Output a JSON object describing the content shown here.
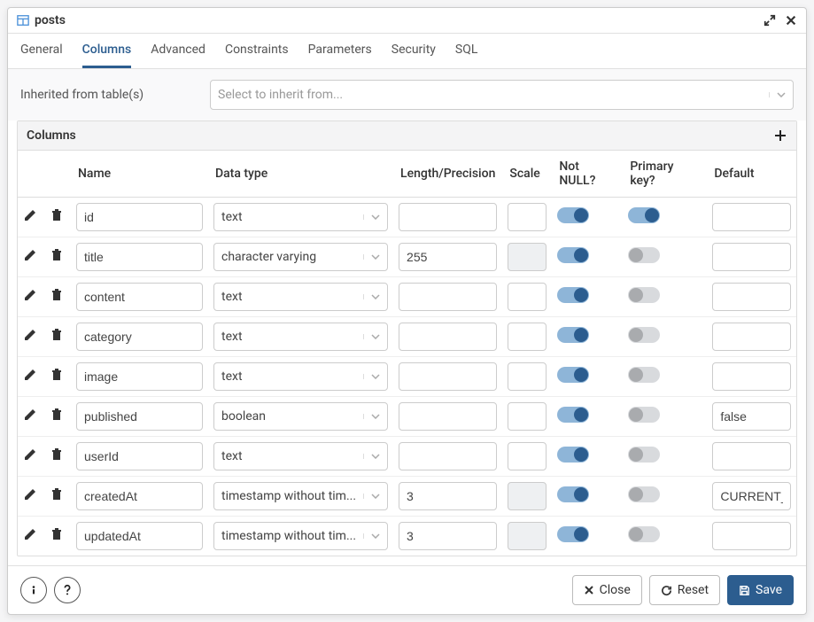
{
  "title": "posts",
  "tabs": [
    "General",
    "Columns",
    "Advanced",
    "Constraints",
    "Parameters",
    "Security",
    "SQL"
  ],
  "active_tab_index": 1,
  "inherit": {
    "label": "Inherited from table(s)",
    "placeholder": "Select to inherit from..."
  },
  "columns_section": {
    "title": "Columns",
    "headers": {
      "name": "Name",
      "datatype": "Data type",
      "length": "Length/Precision",
      "scale": "Scale",
      "notnull": "Not NULL?",
      "pk": "Primary key?",
      "default": "Default"
    },
    "rows": [
      {
        "name": "id",
        "datatype": "text",
        "length": "",
        "scale": "",
        "scale_disabled": false,
        "notnull": true,
        "pk": true,
        "default": ""
      },
      {
        "name": "title",
        "datatype": "character varying",
        "length": "255",
        "scale": "",
        "scale_disabled": true,
        "notnull": true,
        "pk": false,
        "default": ""
      },
      {
        "name": "content",
        "datatype": "text",
        "length": "",
        "scale": "",
        "scale_disabled": false,
        "notnull": true,
        "pk": false,
        "default": ""
      },
      {
        "name": "category",
        "datatype": "text",
        "length": "",
        "scale": "",
        "scale_disabled": false,
        "notnull": true,
        "pk": false,
        "default": ""
      },
      {
        "name": "image",
        "datatype": "text",
        "length": "",
        "scale": "",
        "scale_disabled": false,
        "notnull": true,
        "pk": false,
        "default": ""
      },
      {
        "name": "published",
        "datatype": "boolean",
        "length": "",
        "scale": "",
        "scale_disabled": false,
        "notnull": true,
        "pk": false,
        "default": "false"
      },
      {
        "name": "userId",
        "datatype": "text",
        "length": "",
        "scale": "",
        "scale_disabled": false,
        "notnull": true,
        "pk": false,
        "default": ""
      },
      {
        "name": "createdAt",
        "datatype": "timestamp without tim...",
        "length": "3",
        "scale": "",
        "scale_disabled": true,
        "notnull": true,
        "pk": false,
        "default": "CURRENT_"
      },
      {
        "name": "updatedAt",
        "datatype": "timestamp without tim...",
        "length": "3",
        "scale": "",
        "scale_disabled": true,
        "notnull": true,
        "pk": false,
        "default": ""
      }
    ]
  },
  "footer": {
    "close": "Close",
    "reset": "Reset",
    "save": "Save"
  }
}
